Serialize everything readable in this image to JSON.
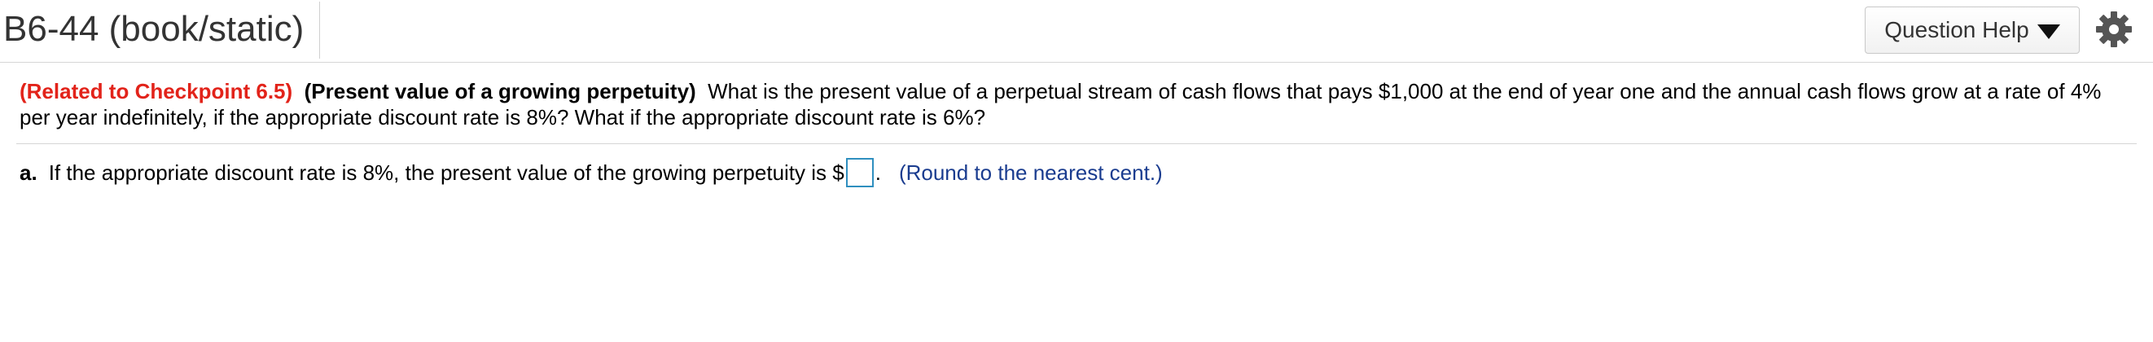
{
  "header": {
    "title": "B6-44 (book/static)",
    "help_label": "Question Help"
  },
  "question": {
    "related": "(Related to Checkpoint 6.5)",
    "topic": "(Present value of a growing perpetuity)",
    "text": "What is the present value of a perpetual stream of cash flows that pays $1,000 at the end of year one and the annual cash flows grow at a rate of 4% per year indefinitely, if the appropriate discount rate is 8%?  What if the appropriate discount rate is 6%?"
  },
  "part_a": {
    "letter": "a.",
    "prompt": "If the appropriate discount rate is 8%, the present value of the growing perpetuity is $",
    "answer_value": "",
    "period": ".",
    "hint": "(Round to the nearest cent.)"
  },
  "colors": {
    "related": "#e2231a",
    "hint": "#1a3c8f",
    "input_border": "#2f8fbf"
  }
}
